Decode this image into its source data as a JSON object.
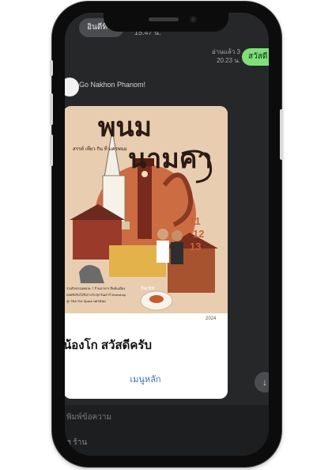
{
  "chat": {
    "top_message": "อินดีที่ได้",
    "top_time": "15:47 น.",
    "sent_read": "อ่านแล้ว 3",
    "sent_time": "20.23 น.",
    "sent_text": "สวัสดี",
    "sender_name": "Go Nakhon Phanom!"
  },
  "poster": {
    "title_line1": "พนม",
    "title_line2": "นามคา",
    "subtitle": "สรรค์ เที่ยว กิน ที่ นครพนม",
    "date_1": "11",
    "date_2": "12",
    "date_3": "13",
    "tag": "รับเชฟ",
    "footer_line1": "ร่วมกิจกรรมพบปะ 7 ร้านอาหาร สืบค้นเมือง",
    "footer_line2": "ถอยฟังรับใจชิงรางวัล ทุกวันเสาร์ Workshop",
    "footer_line3": "@ TBA The Space นครพนม",
    "footer_mark": "2024"
  },
  "card": {
    "title": "น้องโก สวัสดีครับ",
    "menu_link": "เมนูหลัก"
  },
  "input": {
    "placeholder": "พิมพ์ข้อความ",
    "extra": "ฯ  ร้าน"
  },
  "icons": {
    "scroll": "chevron-down-icon",
    "avatar": "avatar"
  },
  "colors": {
    "screen_bg": "#262729",
    "sent_bubble": "#7fe07a",
    "poster_bg": "#e9cdb1",
    "link": "#3a6db5"
  }
}
